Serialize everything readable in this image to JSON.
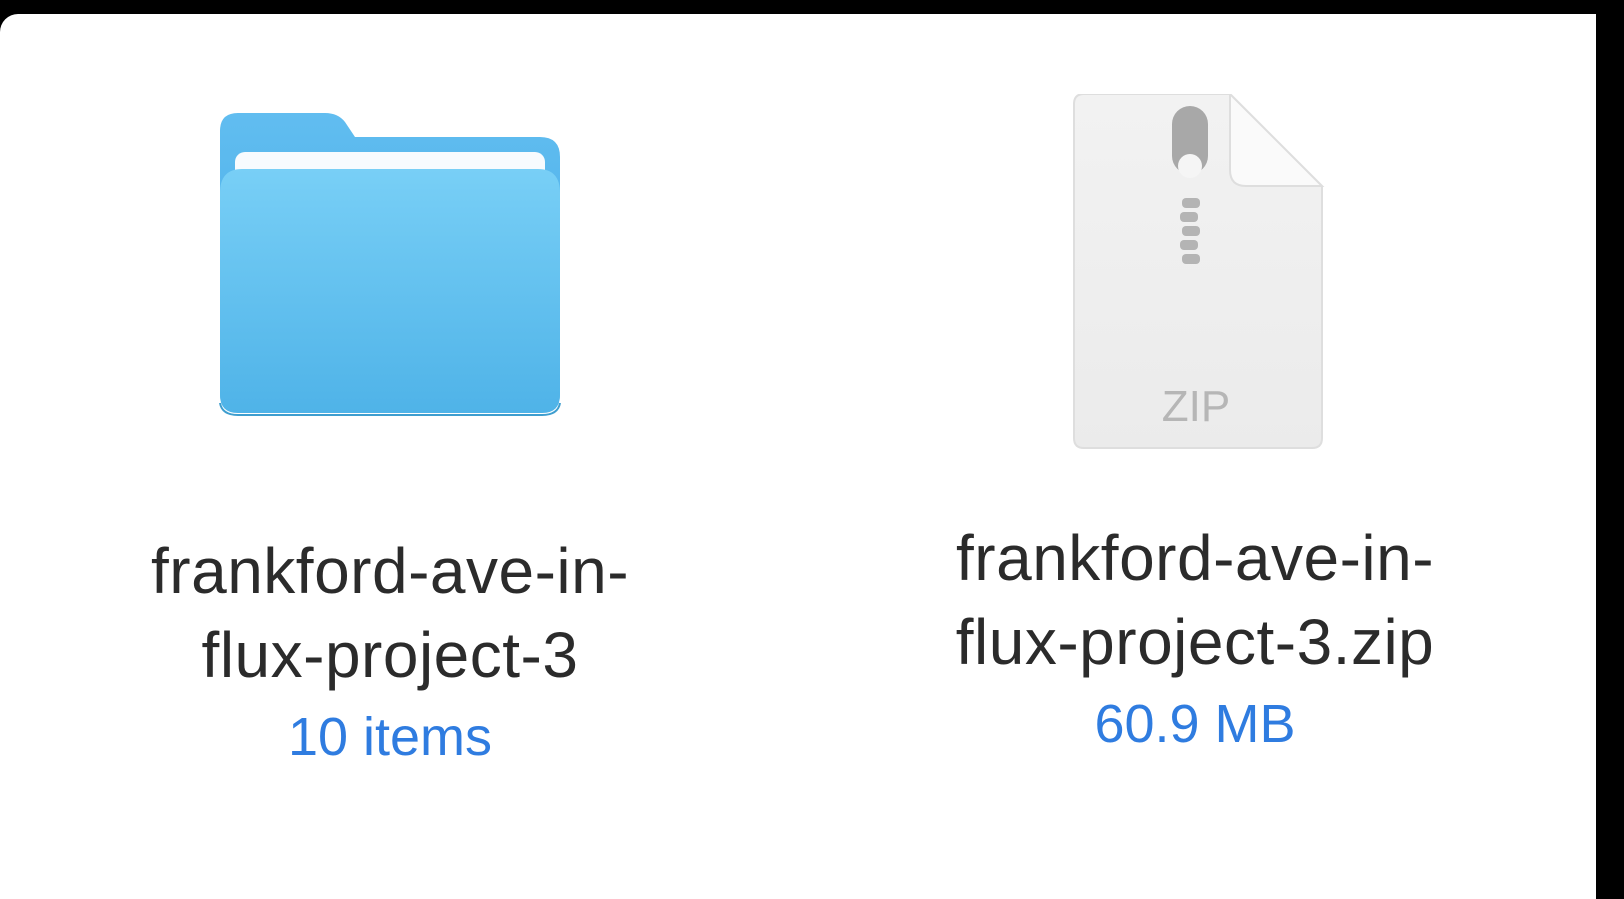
{
  "items": [
    {
      "kind": "folder",
      "icon": "folder-icon",
      "name_lines": [
        "frankford-ave-in-",
        "flux-project-3"
      ],
      "meta": "10 items"
    },
    {
      "kind": "zip",
      "icon": "zip-file-icon",
      "icon_label": "ZIP",
      "name_lines": [
        "frankford-ave-in-",
        "flux-project-3.zip"
      ],
      "meta": "60.9 MB"
    }
  ],
  "colors": {
    "background": "#000000",
    "pane": "#ffffff",
    "folder_blue": "#5ebfee",
    "meta_blue": "#2f7ce0",
    "text": "#2b2b2b"
  }
}
